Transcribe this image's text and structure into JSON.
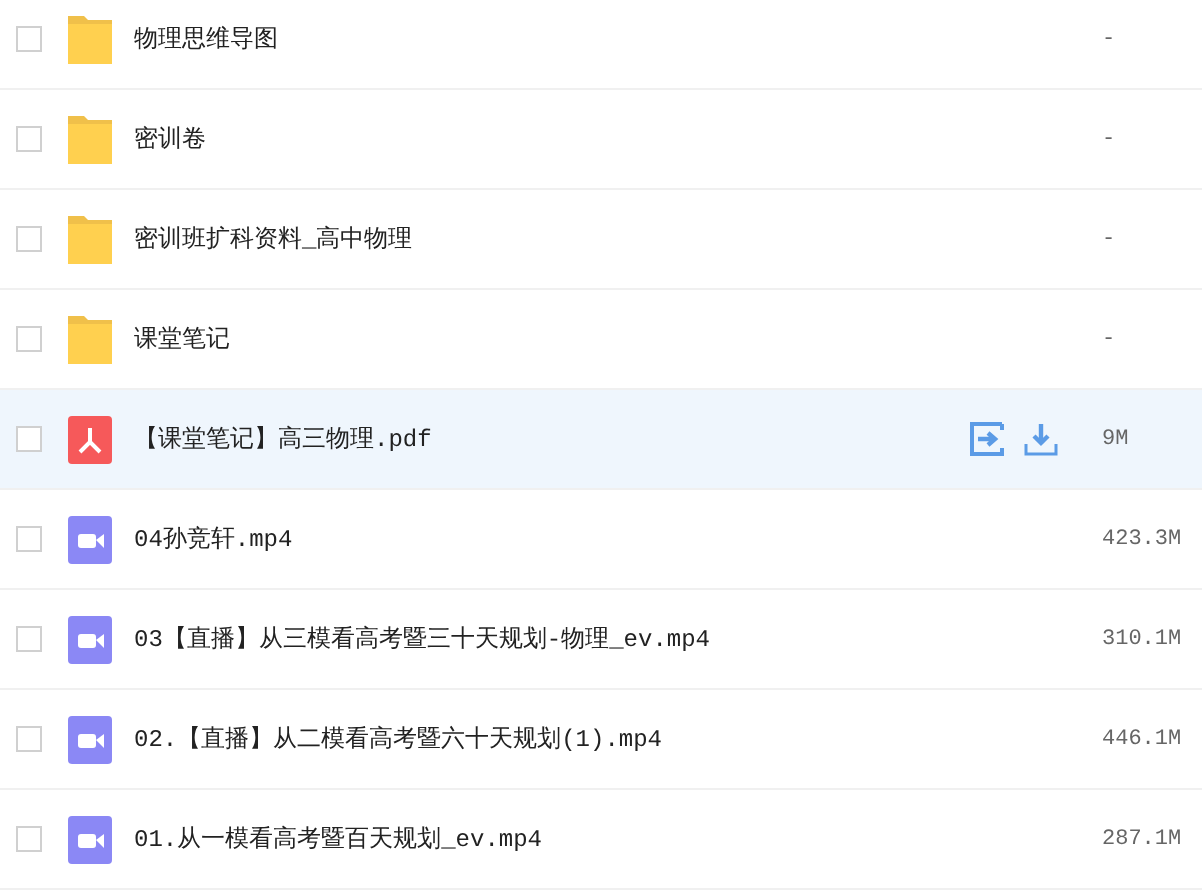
{
  "files": [
    {
      "kind": "folder",
      "name": "物理思维导图",
      "size": "-",
      "checked": false,
      "hovered": false
    },
    {
      "kind": "folder",
      "name": "密训卷",
      "size": "-",
      "checked": false,
      "hovered": false
    },
    {
      "kind": "folder",
      "name": "密训班扩科资料_高中物理",
      "size": "-",
      "checked": false,
      "hovered": false
    },
    {
      "kind": "folder",
      "name": "课堂笔记",
      "size": "-",
      "checked": false,
      "hovered": false
    },
    {
      "kind": "pdf",
      "name": "【课堂笔记】高三物理.pdf",
      "size": "9M",
      "checked": false,
      "hovered": true
    },
    {
      "kind": "video",
      "name": "04孙竞轩.mp4",
      "size": "423.3M",
      "checked": false,
      "hovered": false
    },
    {
      "kind": "video",
      "name": "03【直播】从三模看高考暨三十天规划-物理_ev.mp4",
      "size": "310.1M",
      "checked": false,
      "hovered": false
    },
    {
      "kind": "video",
      "name": "02.【直播】从二模看高考暨六十天规划(1).mp4",
      "size": "446.1M",
      "checked": false,
      "hovered": false
    },
    {
      "kind": "video",
      "name": "01.从一模看高考暨百天规划_ev.mp4",
      "size": "287.1M",
      "checked": false,
      "hovered": false
    }
  ]
}
